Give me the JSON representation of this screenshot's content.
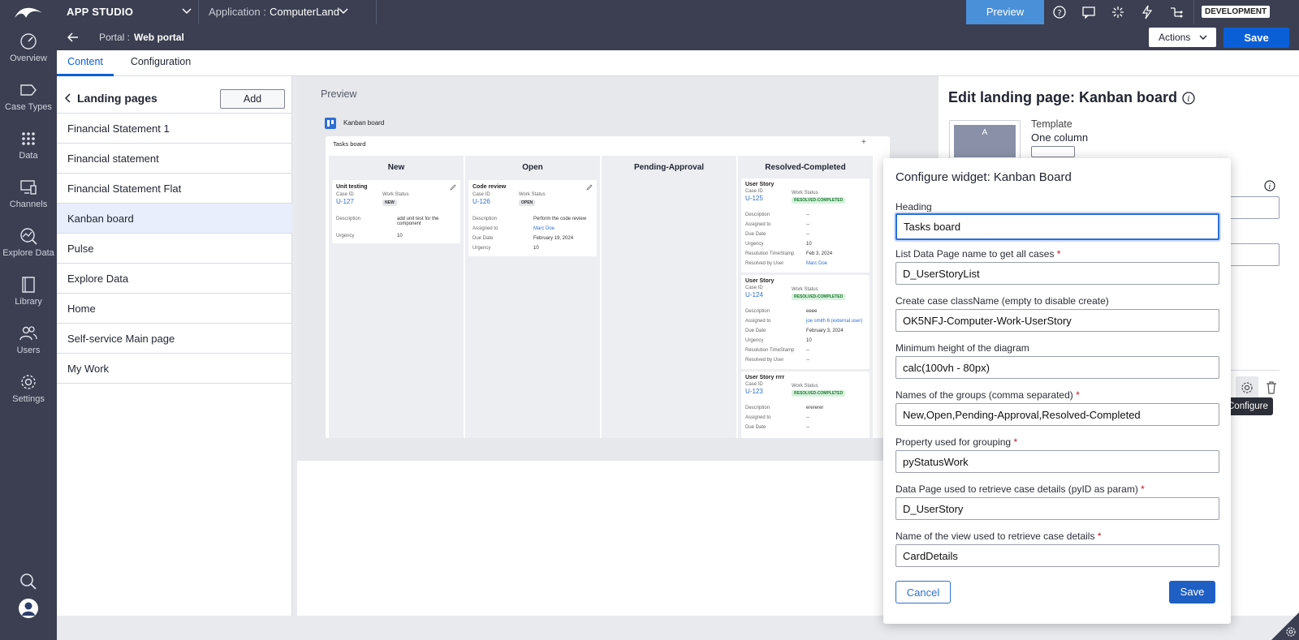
{
  "topbar": {
    "app_name": "APP STUDIO",
    "application_label": "Application :",
    "application_value": "ComputerLand",
    "preview_label": "Preview",
    "env_badge": "DEVELOPMENT",
    "icons": [
      "help-icon",
      "chat-icon",
      "spark-icon",
      "lightning-icon",
      "hierarchy-icon"
    ]
  },
  "subbar": {
    "portal_label": "Portal :",
    "portal_name": "Web portal",
    "actions_label": "Actions",
    "save_label": "Save"
  },
  "tabs": [
    "Content",
    "Configuration"
  ],
  "rail": {
    "items": [
      {
        "label": "Overview",
        "icon": "dashboard-icon"
      },
      {
        "label": "Case Types",
        "icon": "case-types-icon"
      },
      {
        "label": "Data",
        "icon": "data-icon"
      },
      {
        "label": "Channels",
        "icon": "channels-icon"
      },
      {
        "label": "Explore Data",
        "icon": "explore-data-icon"
      },
      {
        "label": "Library",
        "icon": "library-icon"
      },
      {
        "label": "Users",
        "icon": "users-icon"
      },
      {
        "label": "Settings",
        "icon": "settings-icon"
      }
    ]
  },
  "landing": {
    "title": "Landing pages",
    "add_label": "Add",
    "items": [
      "Financial Statement 1",
      "Financial statement",
      "Financial Statement Flat",
      "Kanban board",
      "Pulse",
      "Explore Data",
      "Home",
      "Self-service Main page",
      "My Work"
    ],
    "selected": "Kanban board"
  },
  "preview": {
    "label": "Preview",
    "page_title": "Kanban board",
    "board_title": "Tasks board",
    "columns": [
      "New",
      "Open",
      "Pending-Approval",
      "Resolved-Completed"
    ],
    "cards": {
      "new": {
        "title": "Unit testing",
        "case_id_label": "Case ID",
        "status_label": "Work Status",
        "id": "U-127",
        "status": "NEW",
        "desc_label": "Description",
        "desc": "add unit test for the component",
        "urg_label": "Urgency",
        "urg": "10"
      },
      "open": {
        "title": "Code review",
        "case_id_label": "Case ID",
        "status_label": "Work Status",
        "id": "U-126",
        "status": "OPEN",
        "desc_label": "Description",
        "desc": "Perform the code review",
        "assigned_label": "Assigned to",
        "assigned": "Marc Doe",
        "due_label": "Due Date",
        "due": "February 19, 2024",
        "urg_label": "Urgency",
        "urg": "10"
      },
      "r1": {
        "title": "User Story",
        "case_id_label": "Case ID",
        "status_label": "Work Status",
        "id": "U-125",
        "status": "RESOLVED-COMPLETED",
        "rows": [
          [
            "Description",
            "--"
          ],
          [
            "Assigned to",
            "--"
          ],
          [
            "Due Date",
            "--"
          ],
          [
            "Urgency",
            "10"
          ],
          [
            "Resolution TimeStamp",
            "Feb 3, 2024"
          ],
          [
            "Resolved by User",
            "Marc Doe"
          ]
        ]
      },
      "r2": {
        "title": "User Story",
        "case_id_label": "Case ID",
        "status_label": "Work Status",
        "id": "U-124",
        "status": "RESOLVED-COMPLETED",
        "rows": [
          [
            "Description",
            "eeee"
          ],
          [
            "Assigned to",
            "joe smith 6 (external user)"
          ],
          [
            "Due Date",
            "February 3, 2024"
          ],
          [
            "Urgency",
            "10"
          ],
          [
            "Resolution TimeStamp",
            "--"
          ],
          [
            "Resolved by User",
            "--"
          ]
        ]
      },
      "r3": {
        "title": "User Story rrrr",
        "case_id_label": "Case ID",
        "status_label": "Work Status",
        "id": "U-123",
        "status": "RESOLVED-COMPLETED",
        "rows": [
          [
            "Description",
            "erererer"
          ],
          [
            "Assigned to",
            "--"
          ],
          [
            "Due Date",
            "--"
          ]
        ]
      }
    }
  },
  "edit_panel": {
    "title": "Edit landing page: Kanban board",
    "template_label": "Template",
    "template_value": "One column",
    "thumb_letter": "A",
    "configure_tooltip": "Configure"
  },
  "dialog": {
    "title": "Configure widget: Kanban Board",
    "fields": [
      {
        "label": "Heading",
        "value": "Tasks board",
        "required": false
      },
      {
        "label": "List Data Page name to get all cases",
        "value": "D_UserStoryList",
        "required": true
      },
      {
        "label": "Create case className (empty to disable create)",
        "value": "OK5NFJ-Computer-Work-UserStory",
        "required": false
      },
      {
        "label": "Minimum height of the diagram",
        "value": "calc(100vh - 80px)",
        "required": false
      },
      {
        "label": "Names of the groups (comma separated)",
        "value": "New,Open,Pending-Approval,Resolved-Completed",
        "required": true
      },
      {
        "label": "Property used for grouping",
        "value": "pyStatusWork",
        "required": true
      },
      {
        "label": "Data Page used to retrieve case details (pyID as param)",
        "value": "D_UserStory",
        "required": true
      },
      {
        "label": "Name of the view used to retrieve case details",
        "value": "CardDetails",
        "required": true
      }
    ],
    "required_mark": "*",
    "cancel_label": "Cancel",
    "save_label": "Save"
  },
  "colors": {
    "rail": "#3b3f51",
    "accent": "#0b5fd6",
    "preview_btn": "#4a90d9",
    "selected_row": "#e8eefc"
  }
}
